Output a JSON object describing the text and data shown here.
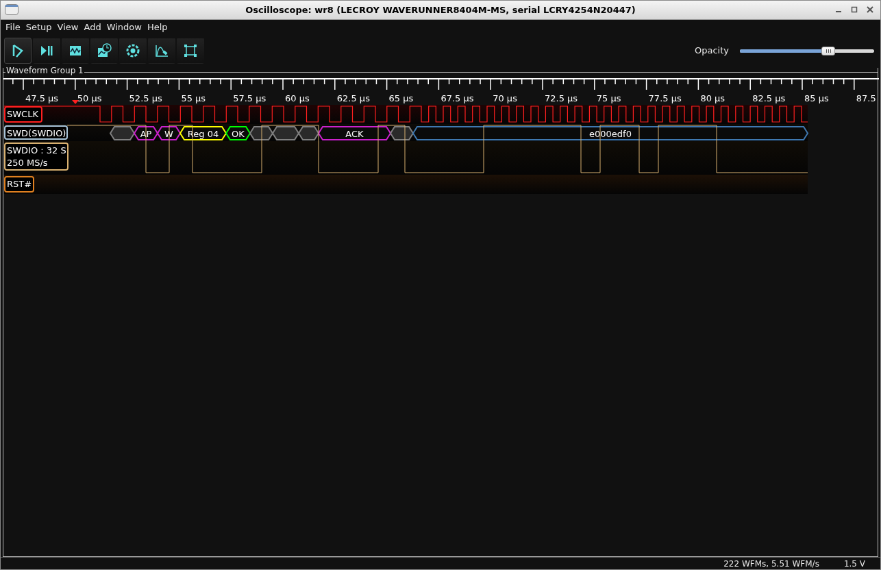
{
  "window": {
    "title": "Oscilloscope: wr8 (LECROY WAVERUNNER8404M-MS, serial LCRY4254N20447)"
  },
  "menu": [
    "File",
    "Setup",
    "View",
    "Add",
    "Window",
    "Help"
  ],
  "toolbar": [
    {
      "kind": "start",
      "selected": true
    },
    {
      "kind": "single",
      "selected": false
    },
    {
      "kind": "waveform",
      "selected": false
    },
    {
      "kind": "history",
      "selected": false
    },
    {
      "kind": "gear",
      "selected": false
    },
    {
      "kind": "curve",
      "selected": false
    },
    {
      "kind": "fit",
      "selected": false
    }
  ],
  "opacity": {
    "label": "Opacity",
    "level": 0.66
  },
  "group": {
    "title": "Waveform Group 1",
    "time_labels": [
      "47.5 µs",
      "50 µs",
      "52.5 µs",
      "55 µs",
      "57.5 µs",
      "60 µs",
      "62.5 µs",
      "65 µs",
      "67.5 µs",
      "70 µs",
      "72.5 µs",
      "75 µs",
      "77.5 µs",
      "80 µs",
      "82.5 µs",
      "85 µs",
      "87.5"
    ],
    "channels": [
      {
        "kind": "clock",
        "name": "SWCLK",
        "color": "#ff2020"
      },
      {
        "kind": "protocol",
        "name": "SWD(SWDIO)",
        "color": "#a8c4d8",
        "packets": [
          {
            "color": "#808080"
          },
          {
            "label": "AP",
            "color": "#cc22cc"
          },
          {
            "label": "W",
            "color": "#cc22cc"
          },
          {
            "label": "Reg 04",
            "color": "#ffff00"
          },
          {
            "label": "OK",
            "color": "#00ff00"
          },
          {
            "color": "#808080"
          },
          {
            "color": "#808080"
          },
          {
            "color": "#808080"
          },
          {
            "label": "ACK",
            "color": "#cc22cc"
          },
          {
            "color": "#808080"
          },
          {
            "label": "e000edf0",
            "color": "#3f78b0"
          }
        ]
      },
      {
        "kind": "analog",
        "name": "SWDIO : 32 S",
        "rate": "250 MS/s",
        "color": "#d8b070"
      },
      {
        "kind": "empty",
        "name": "RST#",
        "color": "#e08020"
      }
    ]
  },
  "status": {
    "rate": "222 WFMs, 5.51 WFM/s",
    "voltage": "1.5 V"
  }
}
